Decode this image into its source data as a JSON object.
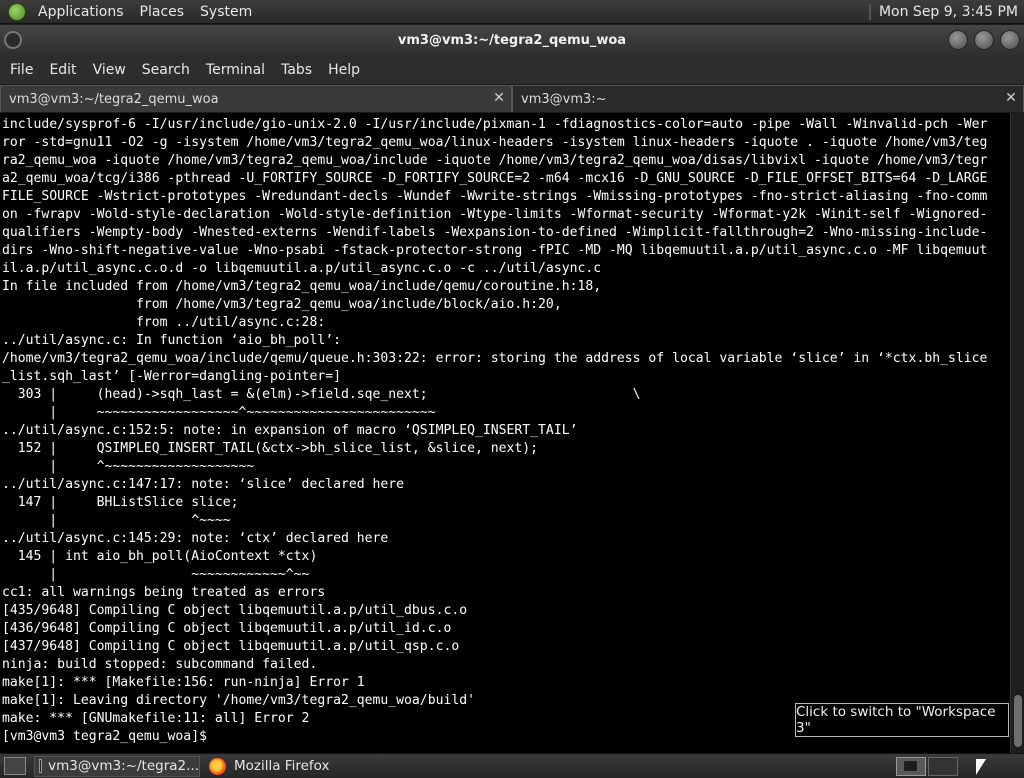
{
  "top_panel": {
    "menu": [
      "Applications",
      "Places",
      "System"
    ],
    "clock": "Mon Sep  9,  3:45 PM"
  },
  "window": {
    "title": "vm3@vm3:~/tegra2_qemu_woa"
  },
  "menubar": [
    "File",
    "Edit",
    "View",
    "Search",
    "Terminal",
    "Tabs",
    "Help"
  ],
  "tabs": [
    {
      "label": "vm3@vm3:~/tegra2_qemu_woa",
      "close": "✕"
    },
    {
      "label": "vm3@vm3:~",
      "close": "✕"
    }
  ],
  "terminal": {
    "lines": [
      "include/sysprof-6 -I/usr/include/gio-unix-2.0 -I/usr/include/pixman-1 -fdiagnostics-color=auto -pipe -Wall -Winvalid-pch -Wer",
      "ror -std=gnu11 -O2 -g -isystem /home/vm3/tegra2_qemu_woa/linux-headers -isystem linux-headers -iquote . -iquote /home/vm3/teg",
      "ra2_qemu_woa -iquote /home/vm3/tegra2_qemu_woa/include -iquote /home/vm3/tegra2_qemu_woa/disas/libvixl -iquote /home/vm3/tegr",
      "a2_qemu_woa/tcg/i386 -pthread -U_FORTIFY_SOURCE -D_FORTIFY_SOURCE=2 -m64 -mcx16 -D_GNU_SOURCE -D_FILE_OFFSET_BITS=64 -D_LARGE",
      "FILE_SOURCE -Wstrict-prototypes -Wredundant-decls -Wundef -Wwrite-strings -Wmissing-prototypes -fno-strict-aliasing -fno-comm",
      "on -fwrapv -Wold-style-declaration -Wold-style-definition -Wtype-limits -Wformat-security -Wformat-y2k -Winit-self -Wignored-",
      "qualifiers -Wempty-body -Wnested-externs -Wendif-labels -Wexpansion-to-defined -Wimplicit-fallthrough=2 -Wno-missing-include-",
      "dirs -Wno-shift-negative-value -Wno-psabi -fstack-protector-strong -fPIC -MD -MQ libqemuutil.a.p/util_async.c.o -MF libqemuut",
      "il.a.p/util_async.c.o.d -o libqemuutil.a.p/util_async.c.o -c ../util/async.c",
      "In file included from /home/vm3/tegra2_qemu_woa/include/qemu/coroutine.h:18,",
      "                 from /home/vm3/tegra2_qemu_woa/include/block/aio.h:20,",
      "                 from ../util/async.c:28:",
      "../util/async.c: In function ‘aio_bh_poll’:",
      "/home/vm3/tegra2_qemu_woa/include/qemu/queue.h:303:22: error: storing the address of local variable ‘slice’ in ‘*ctx.bh_slice",
      "_list.sqh_last’ [-Werror=dangling-pointer=]",
      "  303 |     (head)->sqh_last = &(elm)->field.sqe_next;                          \\",
      "      |     ~~~~~~~~~~~~~~~~~~^~~~~~~~~~~~~~~~~~~~~~~~~",
      "../util/async.c:152:5: note: in expansion of macro ‘QSIMPLEQ_INSERT_TAIL’",
      "  152 |     QSIMPLEQ_INSERT_TAIL(&ctx->bh_slice_list, &slice, next);",
      "      |     ^~~~~~~~~~~~~~~~~~~~",
      "../util/async.c:147:17: note: ‘slice’ declared here",
      "  147 |     BHListSlice slice;",
      "      |                 ^~~~~",
      "../util/async.c:145:29: note: ‘ctx’ declared here",
      "  145 | int aio_bh_poll(AioContext *ctx)",
      "      |                 ~~~~~~~~~~~~^~~",
      "cc1: all warnings being treated as errors",
      "[435/9648] Compiling C object libqemuutil.a.p/util_dbus.c.o",
      "[436/9648] Compiling C object libqemuutil.a.p/util_id.c.o",
      "[437/9648] Compiling C object libqemuutil.a.p/util_qsp.c.o",
      "ninja: build stopped: subcommand failed.",
      "make[1]: *** [Makefile:156: run-ninja] Error 1",
      "make[1]: Leaving directory '/home/vm3/tegra2_qemu_woa/build'",
      "make: *** [GNUmakefile:11: all] Error 2",
      "[vm3@vm3 tegra2_qemu_woa]$ "
    ]
  },
  "tooltip": "Click to switch to \"Workspace 3\"",
  "taskbar": {
    "tasks": [
      {
        "label": "vm3@vm3:~/tegra2...",
        "icon": "terminal-icon"
      },
      {
        "label": "Mozilla Firefox",
        "icon": "firefox-icon"
      }
    ]
  },
  "colors": {
    "terminal_bg": "#000000",
    "terminal_fg": "#ffffff",
    "panel_bg": "#2d2d2d"
  }
}
